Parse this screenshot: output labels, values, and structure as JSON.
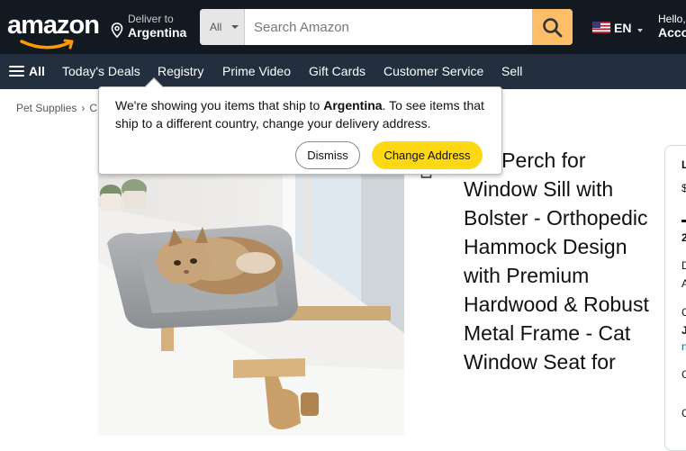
{
  "header": {
    "logo_text": "amazon",
    "deliver_label": "Deliver to",
    "deliver_country": "Argentina",
    "search": {
      "category": "All",
      "placeholder": "Search Amazon"
    },
    "language": "EN",
    "account_greeting": "Hello,",
    "account_label": "Acco"
  },
  "nav": {
    "all_label": "All",
    "items": [
      "Today's Deals",
      "Registry",
      "Prime Video",
      "Gift Cards",
      "Customer Service",
      "Sell"
    ]
  },
  "breadcrumb": [
    "Pet Supplies",
    "C"
  ],
  "popover": {
    "msg_prefix": "We're showing you items that ship to ",
    "msg_country": "Argentina",
    "msg_suffix": ". To see items that ship to a different country, change your delivery address.",
    "dismiss_label": "Dismiss",
    "change_label": "Change Address"
  },
  "product": {
    "title": "Cat Perch for Window Sill with Bolster - Orthopedic Hammock Design with Premium Hardwood & Robust Metal Frame - Cat Window Seat for"
  },
  "buybox_fragments": [
    "L",
    "$",
    "2",
    "D",
    "A",
    "C",
    "J",
    "n",
    "C",
    "C"
  ],
  "colors": {
    "topbar": "#131921",
    "navbar": "#232f3e",
    "search_button": "#febd69",
    "primary_button": "#ffd814"
  }
}
